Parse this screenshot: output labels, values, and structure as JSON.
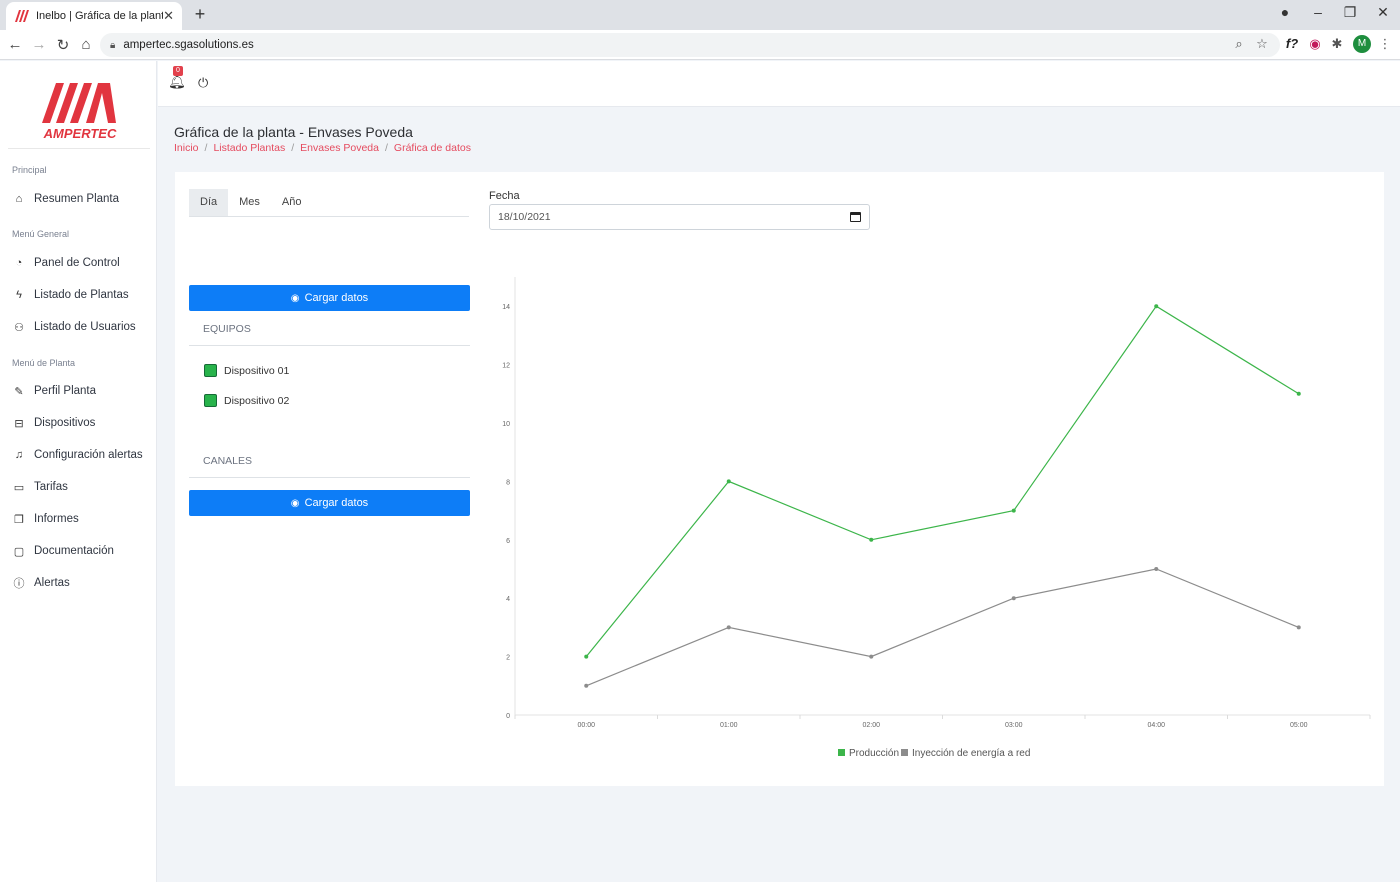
{
  "browser": {
    "tab_title": "Inelbo | Gráfica de la planta",
    "url": "ampertec.sgasolutions.es",
    "profile_initial": "M"
  },
  "sidebar": {
    "brand": "AMPERTEC",
    "brand_color": "#e1353f",
    "sections": [
      {
        "label": "Principal",
        "items": [
          {
            "label": "Resumen Planta",
            "icon": "home-icon"
          }
        ]
      },
      {
        "label": "Menú General",
        "items": [
          {
            "label": "Panel de Control",
            "icon": "gauge-icon"
          },
          {
            "label": "Listado de Plantas",
            "icon": "bolt-icon"
          },
          {
            "label": "Listado de Usuarios",
            "icon": "users-icon"
          }
        ]
      },
      {
        "label": "Menú de Planta",
        "items": [
          {
            "label": "Perfil Planta",
            "icon": "edit-icon"
          },
          {
            "label": "Dispositivos",
            "icon": "inbox-icon"
          },
          {
            "label": "Configuración alertas",
            "icon": "bell-icon"
          },
          {
            "label": "Tarifas",
            "icon": "wallet-icon"
          },
          {
            "label": "Informes",
            "icon": "report-icon"
          },
          {
            "label": "Documentación",
            "icon": "folder-icon"
          },
          {
            "label": "Alertas",
            "icon": "info-icon"
          }
        ]
      }
    ]
  },
  "header": {
    "notification_count": "0"
  },
  "page": {
    "title": "Gráfica de la planta - Envases Poveda",
    "breadcrumb": [
      "Inicio",
      "Listado Plantas",
      "Envases Poveda",
      "Gráfica de datos"
    ]
  },
  "controls": {
    "tabs": [
      "Día",
      "Mes",
      "Año"
    ],
    "active_tab": "Día",
    "fecha_label": "Fecha",
    "fecha_value": "18/10/2021",
    "load_button": "Cargar datos",
    "equipos_title": "EQUIPOS",
    "devices": [
      "Dispositivo 01",
      "Dispositivo 02"
    ],
    "canales_title": "CANALES"
  },
  "chart_data": {
    "type": "line",
    "categories": [
      "00:00",
      "01:00",
      "02:00",
      "03:00",
      "04:00",
      "05:00"
    ],
    "series": [
      {
        "name": "Producción",
        "values": [
          2,
          8,
          6,
          7,
          14,
          11
        ],
        "color": "#3cb54a"
      },
      {
        "name": "Inyección de energía a red",
        "values": [
          1,
          3,
          2,
          4,
          5,
          3
        ],
        "color": "#8c8c8c"
      }
    ],
    "yticks": [
      0,
      2,
      4,
      6,
      8,
      10,
      12,
      14
    ],
    "ylim": [
      0,
      15
    ],
    "legend": "bottom"
  }
}
